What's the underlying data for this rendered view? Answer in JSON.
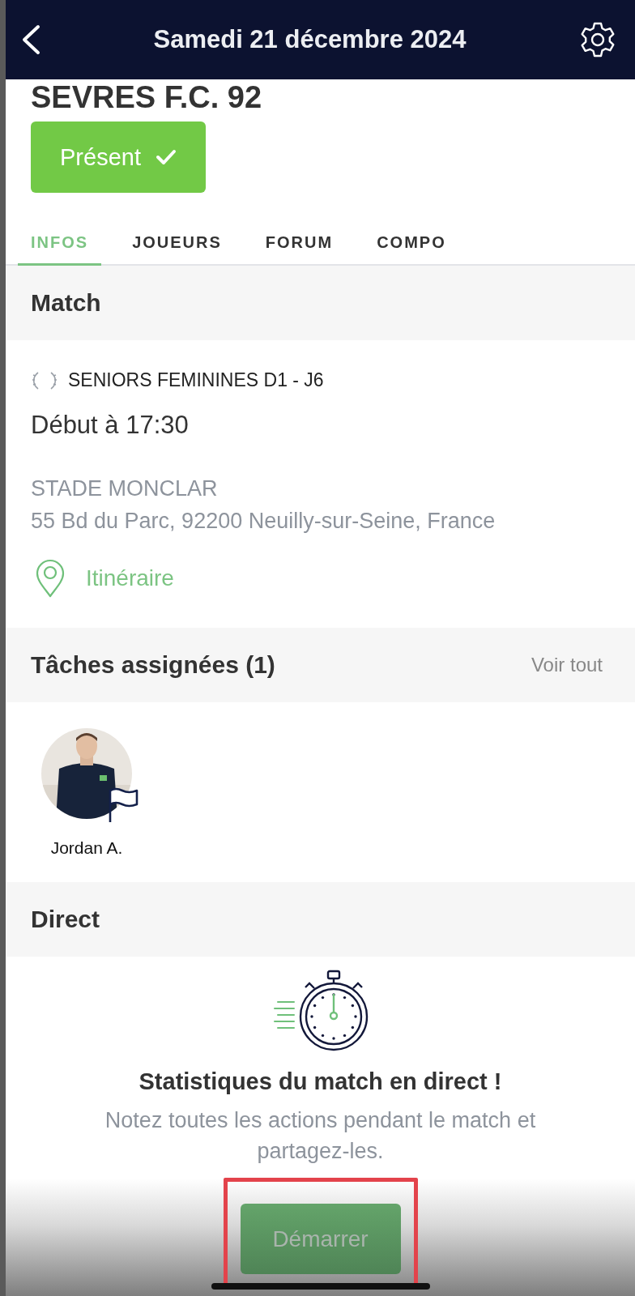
{
  "header": {
    "title": "Samedi 21 décembre 2024"
  },
  "team": {
    "name": "SEVRES F.C. 92"
  },
  "presence": {
    "label": "Présent",
    "confirmed": true
  },
  "tabs": [
    {
      "label": "INFOS",
      "selected": true
    },
    {
      "label": "JOUEURS",
      "selected": false
    },
    {
      "label": "FORUM",
      "selected": false
    },
    {
      "label": "COMPO",
      "selected": false
    }
  ],
  "match": {
    "heading": "Match",
    "competition": "SENIORS FEMININES D1 - J6",
    "start": "Début à 17:30",
    "venue": "STADE MONCLAR",
    "address": "55 Bd du Parc, 92200 Neuilly-sur-Seine, France",
    "directions": "Itinéraire"
  },
  "tasks": {
    "heading": "Tâches assignées (1)",
    "see_all": "Voir tout",
    "people": [
      {
        "name": "Jordan A."
      }
    ]
  },
  "live": {
    "heading": "Direct",
    "title": "Statistiques du match en direct !",
    "description": "Notez toutes les actions pendant le match et partagez-les.",
    "start_button": "Démarrer"
  }
}
